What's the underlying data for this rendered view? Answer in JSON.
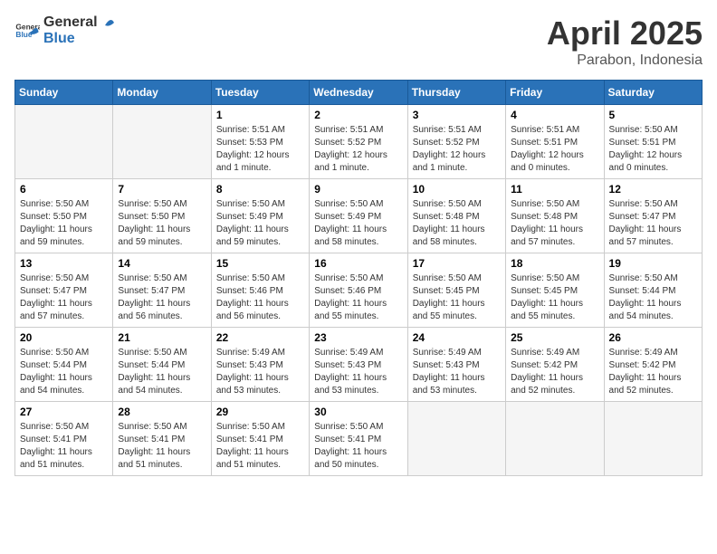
{
  "header": {
    "logo_general": "General",
    "logo_blue": "Blue",
    "title": "April 2025",
    "location": "Parabon, Indonesia"
  },
  "calendar": {
    "weekdays": [
      "Sunday",
      "Monday",
      "Tuesday",
      "Wednesday",
      "Thursday",
      "Friday",
      "Saturday"
    ],
    "weeks": [
      [
        {
          "day": "",
          "empty": true
        },
        {
          "day": "",
          "empty": true
        },
        {
          "day": "1",
          "detail": "Sunrise: 5:51 AM\nSunset: 5:53 PM\nDaylight: 12 hours\nand 1 minute."
        },
        {
          "day": "2",
          "detail": "Sunrise: 5:51 AM\nSunset: 5:52 PM\nDaylight: 12 hours\nand 1 minute."
        },
        {
          "day": "3",
          "detail": "Sunrise: 5:51 AM\nSunset: 5:52 PM\nDaylight: 12 hours\nand 1 minute."
        },
        {
          "day": "4",
          "detail": "Sunrise: 5:51 AM\nSunset: 5:51 PM\nDaylight: 12 hours\nand 0 minutes."
        },
        {
          "day": "5",
          "detail": "Sunrise: 5:50 AM\nSunset: 5:51 PM\nDaylight: 12 hours\nand 0 minutes."
        }
      ],
      [
        {
          "day": "6",
          "detail": "Sunrise: 5:50 AM\nSunset: 5:50 PM\nDaylight: 11 hours\nand 59 minutes."
        },
        {
          "day": "7",
          "detail": "Sunrise: 5:50 AM\nSunset: 5:50 PM\nDaylight: 11 hours\nand 59 minutes."
        },
        {
          "day": "8",
          "detail": "Sunrise: 5:50 AM\nSunset: 5:49 PM\nDaylight: 11 hours\nand 59 minutes."
        },
        {
          "day": "9",
          "detail": "Sunrise: 5:50 AM\nSunset: 5:49 PM\nDaylight: 11 hours\nand 58 minutes."
        },
        {
          "day": "10",
          "detail": "Sunrise: 5:50 AM\nSunset: 5:48 PM\nDaylight: 11 hours\nand 58 minutes."
        },
        {
          "day": "11",
          "detail": "Sunrise: 5:50 AM\nSunset: 5:48 PM\nDaylight: 11 hours\nand 57 minutes."
        },
        {
          "day": "12",
          "detail": "Sunrise: 5:50 AM\nSunset: 5:47 PM\nDaylight: 11 hours\nand 57 minutes."
        }
      ],
      [
        {
          "day": "13",
          "detail": "Sunrise: 5:50 AM\nSunset: 5:47 PM\nDaylight: 11 hours\nand 57 minutes."
        },
        {
          "day": "14",
          "detail": "Sunrise: 5:50 AM\nSunset: 5:47 PM\nDaylight: 11 hours\nand 56 minutes."
        },
        {
          "day": "15",
          "detail": "Sunrise: 5:50 AM\nSunset: 5:46 PM\nDaylight: 11 hours\nand 56 minutes."
        },
        {
          "day": "16",
          "detail": "Sunrise: 5:50 AM\nSunset: 5:46 PM\nDaylight: 11 hours\nand 55 minutes."
        },
        {
          "day": "17",
          "detail": "Sunrise: 5:50 AM\nSunset: 5:45 PM\nDaylight: 11 hours\nand 55 minutes."
        },
        {
          "day": "18",
          "detail": "Sunrise: 5:50 AM\nSunset: 5:45 PM\nDaylight: 11 hours\nand 55 minutes."
        },
        {
          "day": "19",
          "detail": "Sunrise: 5:50 AM\nSunset: 5:44 PM\nDaylight: 11 hours\nand 54 minutes."
        }
      ],
      [
        {
          "day": "20",
          "detail": "Sunrise: 5:50 AM\nSunset: 5:44 PM\nDaylight: 11 hours\nand 54 minutes."
        },
        {
          "day": "21",
          "detail": "Sunrise: 5:50 AM\nSunset: 5:44 PM\nDaylight: 11 hours\nand 54 minutes."
        },
        {
          "day": "22",
          "detail": "Sunrise: 5:49 AM\nSunset: 5:43 PM\nDaylight: 11 hours\nand 53 minutes."
        },
        {
          "day": "23",
          "detail": "Sunrise: 5:49 AM\nSunset: 5:43 PM\nDaylight: 11 hours\nand 53 minutes."
        },
        {
          "day": "24",
          "detail": "Sunrise: 5:49 AM\nSunset: 5:43 PM\nDaylight: 11 hours\nand 53 minutes."
        },
        {
          "day": "25",
          "detail": "Sunrise: 5:49 AM\nSunset: 5:42 PM\nDaylight: 11 hours\nand 52 minutes."
        },
        {
          "day": "26",
          "detail": "Sunrise: 5:49 AM\nSunset: 5:42 PM\nDaylight: 11 hours\nand 52 minutes."
        }
      ],
      [
        {
          "day": "27",
          "detail": "Sunrise: 5:50 AM\nSunset: 5:41 PM\nDaylight: 11 hours\nand 51 minutes."
        },
        {
          "day": "28",
          "detail": "Sunrise: 5:50 AM\nSunset: 5:41 PM\nDaylight: 11 hours\nand 51 minutes."
        },
        {
          "day": "29",
          "detail": "Sunrise: 5:50 AM\nSunset: 5:41 PM\nDaylight: 11 hours\nand 51 minutes."
        },
        {
          "day": "30",
          "detail": "Sunrise: 5:50 AM\nSunset: 5:41 PM\nDaylight: 11 hours\nand 50 minutes."
        },
        {
          "day": "",
          "empty": true
        },
        {
          "day": "",
          "empty": true
        },
        {
          "day": "",
          "empty": true
        }
      ]
    ]
  }
}
